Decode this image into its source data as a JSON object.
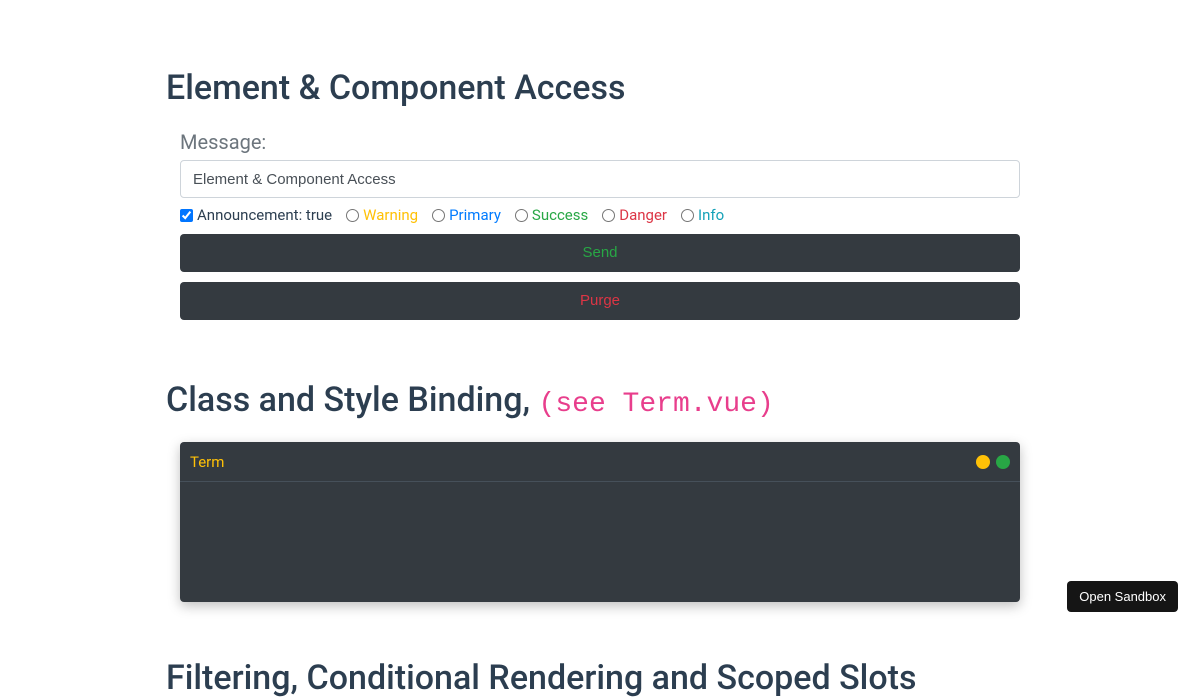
{
  "section1": {
    "heading": "Element & Component Access",
    "message_label": "Message:",
    "message_value": "Element & Component Access",
    "announcement_checked": true,
    "announcement_label": "Announcement: true",
    "radios": [
      {
        "label": "Warning",
        "class": "c-warning"
      },
      {
        "label": "Primary",
        "class": "c-primary"
      },
      {
        "label": "Success",
        "class": "c-success"
      },
      {
        "label": "Danger",
        "class": "c-danger"
      },
      {
        "label": "Info",
        "class": "c-info"
      }
    ],
    "send_label": "Send",
    "purge_label": "Purge"
  },
  "section2": {
    "heading_main": "Class and Style Binding, ",
    "heading_note": "(see Term.vue)",
    "term_title": "Term"
  },
  "section3": {
    "heading": "Filtering, Conditional Rendering and Scoped Slots"
  },
  "sandbox_button": "Open Sandbox"
}
